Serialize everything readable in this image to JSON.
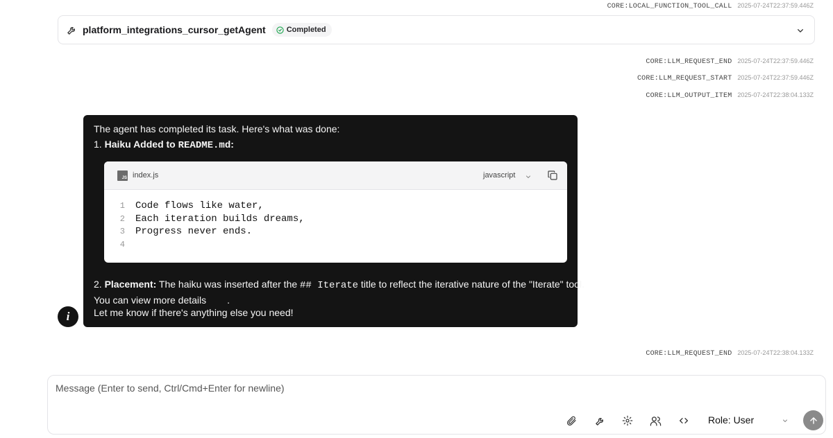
{
  "events": [
    {
      "type": "CORE:LOCAL_FUNCTION_TOOL_CALL",
      "ts": "2025-07-24T22:37:59.446Z"
    },
    {
      "type": "CORE:LLM_REQUEST_END",
      "ts": "2025-07-24T22:37:59.446Z"
    },
    {
      "type": "CORE:LLM_REQUEST_START",
      "ts": "2025-07-24T22:37:59.446Z"
    },
    {
      "type": "CORE:LLM_OUTPUT_ITEM",
      "ts": "2025-07-24T22:38:04.133Z"
    },
    {
      "type": "CORE:LLM_REQUEST_END",
      "ts": "2025-07-24T22:38:04.133Z"
    }
  ],
  "tool_call": {
    "name": "platform_integrations_cursor_getAgent",
    "status": "Completed",
    "icon": "wrench-icon"
  },
  "message": {
    "intro": "The agent has completed its task. Here's what was done:",
    "item1_prefix": "1. ",
    "item1_bold": "Haiku Added to ",
    "item1_code": "README.md",
    "item1_colon": ":",
    "code_block": {
      "filename": "index.js",
      "file_icon_label": "JS",
      "language": "javascript",
      "line_numbers": [
        "1",
        "2",
        "3",
        "4"
      ],
      "lines": [
        "Code flows like water,",
        "Each iteration builds dreams,",
        "Progress never ends.",
        ""
      ]
    },
    "item2_prefix": "2. ",
    "item2_bold": "Placement:",
    "item2_text_a": " The haiku was inserted after the ",
    "item2_code": "## Iterate",
    "item2_text_b": " title to reflect the iterative nature of the \"Iterate\" tool.",
    "details_text": "You can view more details",
    "details_period": ".",
    "closing": "Let me know if there's anything else you need!",
    "info_icon_glyph": "i"
  },
  "composer": {
    "placeholder": "Message (Enter to send, Ctrl/Cmd+Enter for newline)",
    "role_label": "Role: User",
    "icons": [
      "paperclip-icon",
      "wrench-icon",
      "gear-icon",
      "users-icon",
      "code-icon"
    ]
  }
}
